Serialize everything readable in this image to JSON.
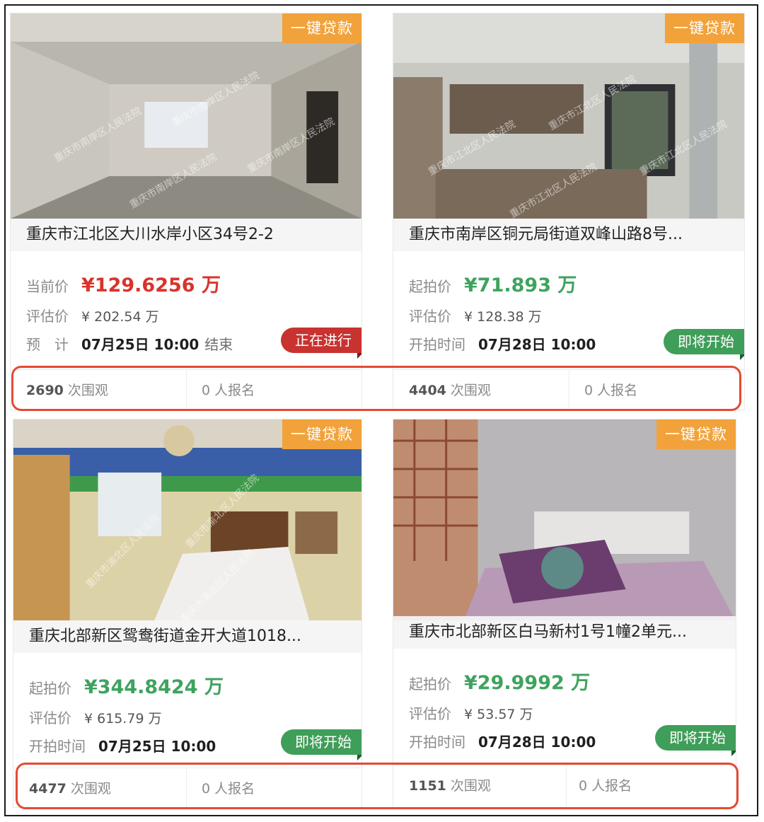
{
  "listings": [
    {
      "loan_badge": "一键贷款",
      "title": "重庆市江北区大川水岸小区34号2-2",
      "price_label": "当前价",
      "price": "¥129.6256 万",
      "estimate_label": "评估价",
      "estimate": "¥ 202.54 万",
      "time_label": "预　计",
      "time": "07月25日 10:00",
      "time_suffix": "结束",
      "status": "正在进行",
      "views_count": "2690",
      "views_label": "次围观",
      "signups": "0 人报名",
      "watermark": "重庆市南岸区人民法院"
    },
    {
      "loan_badge": "一键贷款",
      "title": "重庆市南岸区铜元局街道双峰山路8号...",
      "price_label": "起拍价",
      "price": "¥71.893 万",
      "estimate_label": "评估价",
      "estimate": "¥ 128.38 万",
      "time_label": "开拍时间",
      "time": "07月28日 10:00",
      "time_suffix": "",
      "status": "即将开始",
      "views_count": "4404",
      "views_label": "次围观",
      "signups": "0 人报名",
      "watermark": "重庆市江北区人民法院"
    },
    {
      "loan_badge": "一键贷款",
      "title": "重庆北部新区鸳鸯街道金开大道1018...",
      "price_label": "起拍价",
      "price": "¥344.8424 万",
      "estimate_label": "评估价",
      "estimate": "¥ 615.79 万",
      "time_label": "开拍时间",
      "time": "07月25日 10:00",
      "time_suffix": "",
      "status": "即将开始",
      "views_count": "4477",
      "views_label": "次围观",
      "signups": "0 人报名",
      "watermark": "重庆市渝北区人民法院"
    },
    {
      "loan_badge": "一键贷款",
      "title": "重庆市北部新区白马新村1号1幢2单元...",
      "price_label": "起拍价",
      "price": "¥29.9992 万",
      "estimate_label": "评估价",
      "estimate": "¥ 53.57 万",
      "time_label": "开拍时间",
      "time": "07月28日 10:00",
      "time_suffix": "",
      "status": "即将开始",
      "views_count": "1151",
      "views_label": "次围观",
      "signups": "0 人报名",
      "watermark": ""
    }
  ],
  "colors": {
    "price_red": "#d8342c",
    "price_green": "#3fa35f",
    "loan_badge": "#f2a23a",
    "status_active": "#c8332f",
    "status_upcoming": "#3f9e59",
    "highlight_box": "#e44a33"
  }
}
